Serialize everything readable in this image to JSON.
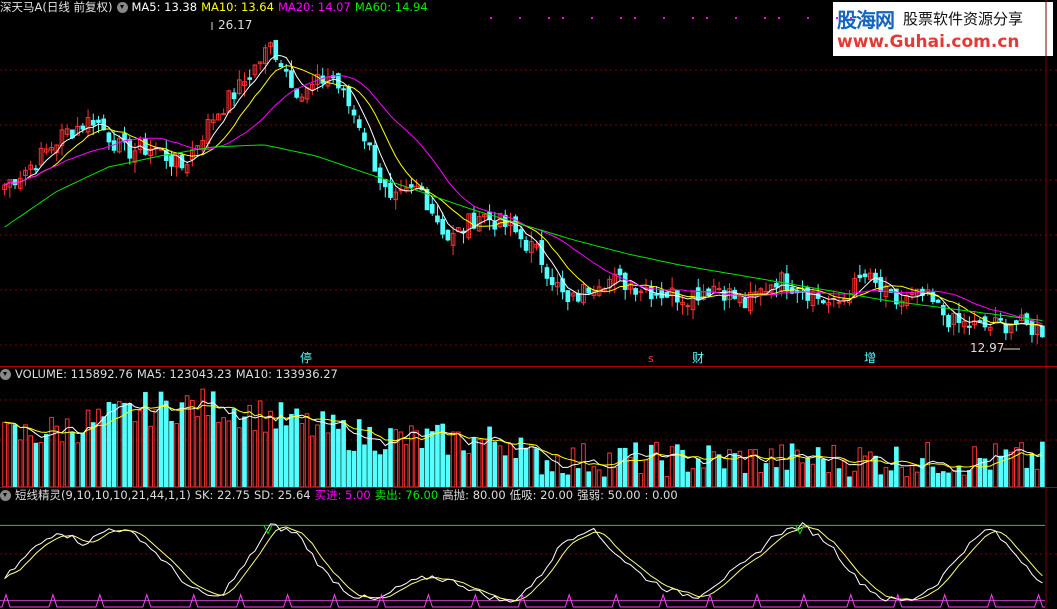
{
  "header": {
    "stock": "深天马A(日线 前复权)",
    "ma5": "MA5: 13.38",
    "ma10": "MA10: 13.64",
    "ma20": "MA20: 14.07",
    "ma60": "MA60: 14.94"
  },
  "watermark": {
    "brand": "股海网",
    "slogan": "股票软件资源分享",
    "url": "www.Guhai.com.cn"
  },
  "price_panel": {
    "high_label": "26.17",
    "low_label": "12.97",
    "markers": [
      "停",
      "s",
      "财",
      "增"
    ]
  },
  "volume_header": {
    "volume": "VOLUME: 115892.76",
    "ma5": "MA5: 123043.23",
    "ma10": "MA10: 133936.27"
  },
  "indicator_header": {
    "name": "短线精灵(9,10,10,10,21,44,1,1)",
    "sk": "SK: 22.75",
    "sd": "SD: 25.64",
    "buy": "买进: 5.00",
    "sell": "卖出: 76.00",
    "high": "高抛: 80.00",
    "low": "低吸: 20.00",
    "strength": "强弱: 50.00",
    "extra": ": 0.00"
  },
  "colors": {
    "up": "#ff3232",
    "down": "#54ffff",
    "ma5": "#ffffff",
    "ma10": "#ffff00",
    "ma20": "#ff00ff",
    "ma60": "#00e600",
    "separator": "#b00000"
  },
  "chart_data": [
    {
      "type": "candlestick",
      "price_ylim": [
        12.3,
        27.0
      ],
      "close_path": [
        19.5,
        20.5,
        21.8,
        22.5,
        21.0,
        21.2,
        20.3,
        22.5,
        24.0,
        25.8,
        23.5,
        24.5,
        22.2,
        18.6,
        19.4,
        17.0,
        18.2,
        17.6,
        16.4,
        14.1,
        15.3,
        15.1,
        14.7,
        14.5,
        15.0,
        14.1,
        15.3,
        14.8,
        14.0,
        15.4,
        14.2,
        14.5,
        13.3,
        13.1,
        13.3,
        12.97
      ],
      "ma60_path": [
        17.6,
        19.2,
        20.3,
        20.8,
        21.2,
        21.3,
        20.8,
        20.0,
        19.2,
        18.4,
        17.7,
        17.0,
        16.4,
        15.9,
        15.5,
        15.1,
        14.7,
        14.3,
        14.0,
        13.7,
        13.4
      ],
      "high_label_value": 26.17,
      "low_label_value": 12.97
    },
    {
      "type": "bar",
      "name": "VOLUME",
      "latest": 115892.76,
      "ma5": 123043.23,
      "ma10": 133936.27
    },
    {
      "type": "line",
      "name": "短线精灵",
      "ylim": [
        0,
        100
      ],
      "reference_lines": [
        80,
        20,
        50
      ],
      "sk_path": [
        28,
        55,
        75,
        62,
        78,
        70,
        45,
        18,
        8,
        40,
        80,
        72,
        35,
        12,
        6,
        22,
        30,
        24,
        12,
        4,
        26,
        64,
        78,
        52,
        30,
        16,
        10,
        28,
        46,
        72,
        80,
        62,
        28,
        8,
        6,
        22,
        55,
        78,
        52,
        24
      ]
    }
  ]
}
